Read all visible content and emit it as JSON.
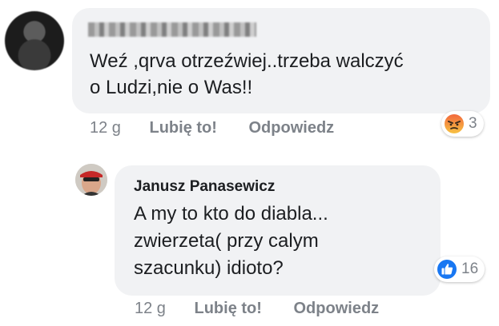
{
  "comment1": {
    "text_line1": "Weź ,qrva otrzeźwiej..trzeba walczyć",
    "text_line2": "o Ludzi,nie o Was!!",
    "time": "12 g",
    "like_label": "Lubię to!",
    "reply_label": "Odpowiedz",
    "reaction_icon": "angry-icon",
    "reaction_count": "3"
  },
  "comment2": {
    "author": "Janusz Panasewicz",
    "text_line1": "A my to kto do diabla...",
    "text_line2": "zwierzeta( przy calym",
    "text_line3": "szacunku) idioto?",
    "time": "12 g",
    "like_label": "Lubię to!",
    "reply_label": "Odpowiedz",
    "reaction_icon": "like-icon",
    "reaction_count": "16"
  },
  "colors": {
    "bubble": "#f1f2f4",
    "text": "#1c1e21",
    "meta": "#7d8289",
    "like_blue": "#1877f2",
    "angry_orange": "#f2683c"
  }
}
